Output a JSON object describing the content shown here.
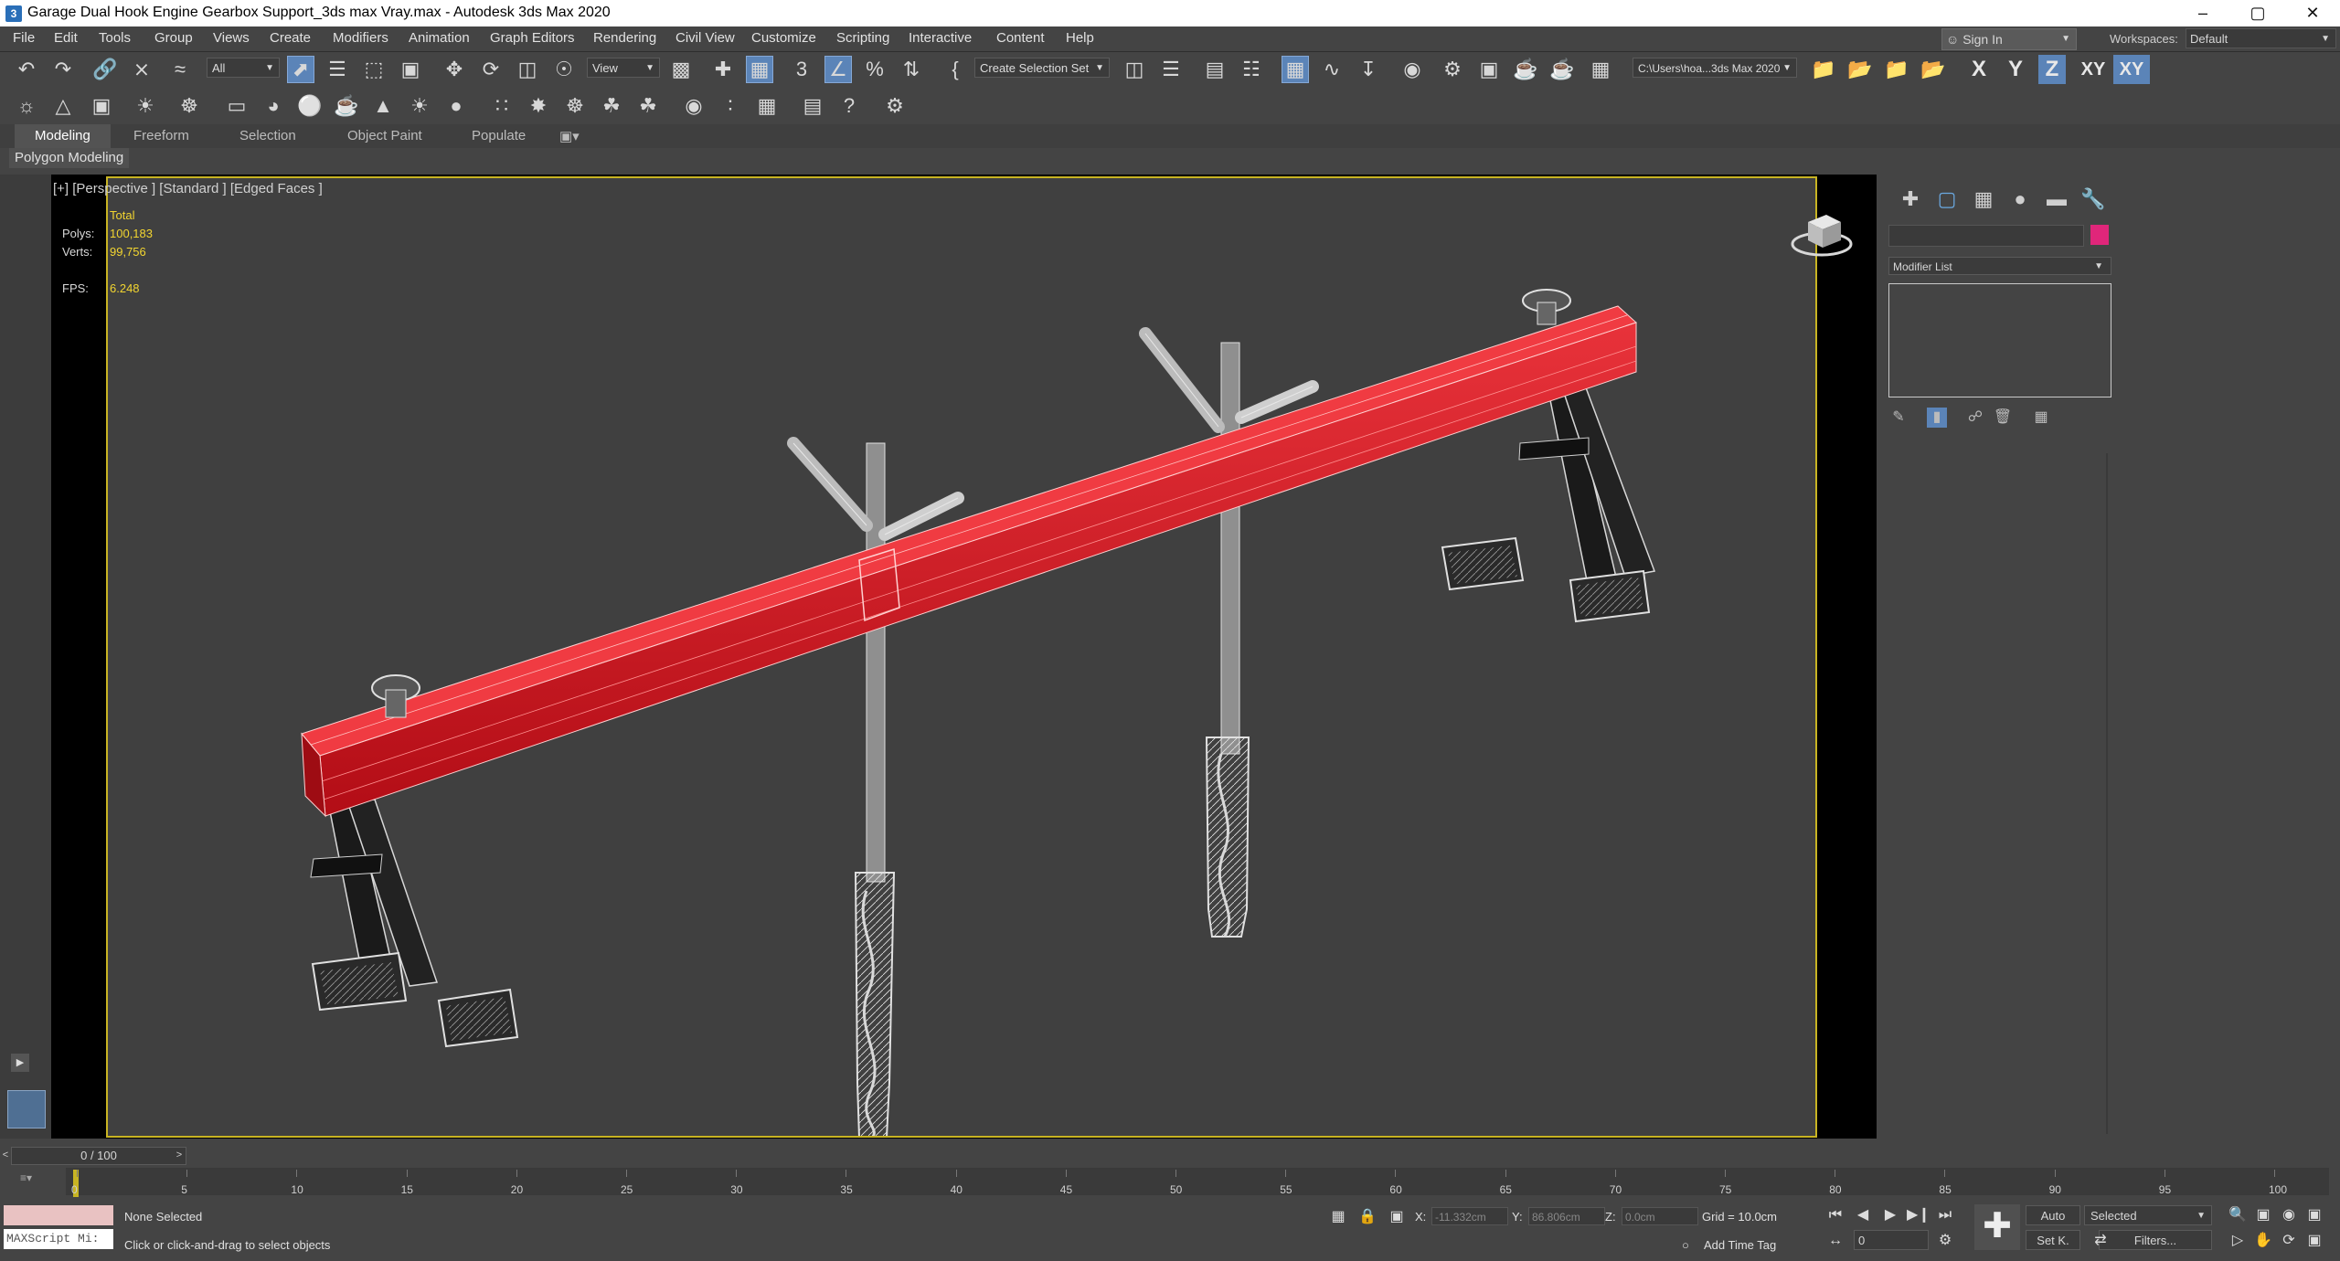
{
  "window": {
    "app_icon": "3",
    "title": "Garage Dual Hook Engine Gearbox Support_3ds max Vray.max - Autodesk 3ds Max 2020",
    "minimize": "–",
    "maximize": "▢",
    "close": "✕"
  },
  "menu": [
    "File",
    "Edit",
    "Tools",
    "Group",
    "Views",
    "Create",
    "Modifiers",
    "Animation",
    "Graph Editors",
    "Rendering",
    "Civil View",
    "Customize",
    "Scripting",
    "Interactive",
    "Content",
    "Help"
  ],
  "account": {
    "signin": "Sign In",
    "workspaces_label": "Workspaces:",
    "workspace": "Default"
  },
  "toolbar": {
    "selection_filter": "All",
    "ref_coord": "View",
    "selection_set": "Create Selection Set",
    "project_path": "C:\\Users\\hoa...3ds Max 2020",
    "axes": [
      "X",
      "Y",
      "Z",
      "XY",
      "XY"
    ]
  },
  "ribbon": {
    "tabs": [
      "Modeling",
      "Freeform",
      "Selection",
      "Object Paint",
      "Populate"
    ],
    "active_tab": "Modeling",
    "panel": "Polygon Modeling"
  },
  "viewport": {
    "label": "[+] [Perspective ] [Standard ] [Edged Faces ]",
    "stats": {
      "header": "Total",
      "polys_label": "Polys:",
      "polys": "100,183",
      "verts_label": "Verts:",
      "verts": "99,756",
      "fps_label": "FPS:",
      "fps": "6.248"
    },
    "colors": {
      "beam": "#c8101a",
      "frame_highlight": "#c8b423",
      "background": "#404040"
    }
  },
  "command_panel": {
    "tabs": [
      "create-icon",
      "modify-icon",
      "hierarchy-icon",
      "motion-icon",
      "display-icon",
      "utilities-icon"
    ],
    "modifier_list": "Modifier List",
    "object_color": "#e0267a"
  },
  "timeline": {
    "frame": "0 / 100",
    "ticks": [
      "0",
      "5",
      "10",
      "15",
      "20",
      "25",
      "30",
      "35",
      "40",
      "45",
      "50",
      "55",
      "60",
      "65",
      "70",
      "75",
      "80",
      "85",
      "90",
      "95",
      "100"
    ]
  },
  "status": {
    "maxscript": "MAXScript Mi:",
    "selection": "None Selected",
    "prompt": "Click or click-and-drag to select objects",
    "x_label": "X:",
    "x": "-11.332cm",
    "y_label": "Y:",
    "y": "86.806cm",
    "z_label": "Z:",
    "z": "0.0cm",
    "grid": "Grid = 10.0cm",
    "add_time_tag": "Add Time Tag",
    "auto": "Auto",
    "set_key": "Set K.",
    "key_filter": "Selected",
    "filters": "Filters...",
    "current_frame": "0"
  }
}
